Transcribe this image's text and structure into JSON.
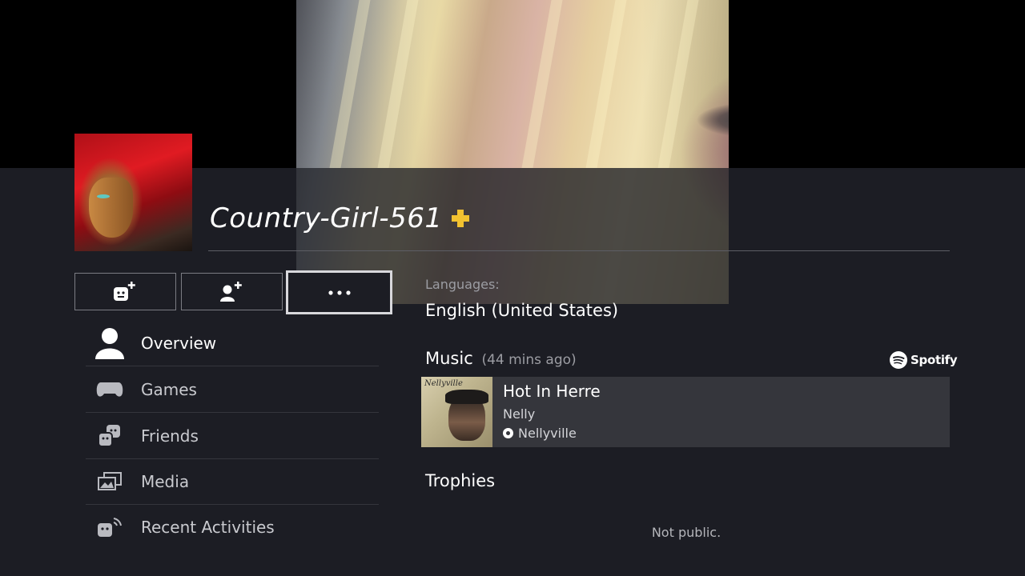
{
  "profile": {
    "username": "Country-Girl-561",
    "plus_member": true
  },
  "actions": [
    {
      "name": "add-friend-emoji-button",
      "icon": "face-plus-icon"
    },
    {
      "name": "add-friend-button",
      "icon": "person-plus-icon"
    },
    {
      "name": "more-options-button",
      "icon": "ellipsis-icon",
      "selected": true
    }
  ],
  "menu": {
    "items": [
      {
        "label": "Overview",
        "icon": "person-icon",
        "active": true
      },
      {
        "label": "Games",
        "icon": "controller-icon"
      },
      {
        "label": "Friends",
        "icon": "friends-icon"
      },
      {
        "label": "Media",
        "icon": "media-icon"
      },
      {
        "label": "Recent Activities",
        "icon": "activity-icon"
      }
    ]
  },
  "details": {
    "languages_label": "Languages:",
    "languages_value": "English (United States)",
    "music_label": "Music",
    "music_time": "(44 mins ago)",
    "service": "Spotify",
    "track": {
      "title": "Hot In Herre",
      "artist": "Nelly",
      "album": "Nellyville",
      "album_art_text": "Nellyville"
    },
    "trophies_label": "Trophies",
    "trophies_status": "Not public."
  },
  "colors": {
    "background": "#1c1d24",
    "plus_gold": "#f2c230",
    "card": "#35363c"
  }
}
